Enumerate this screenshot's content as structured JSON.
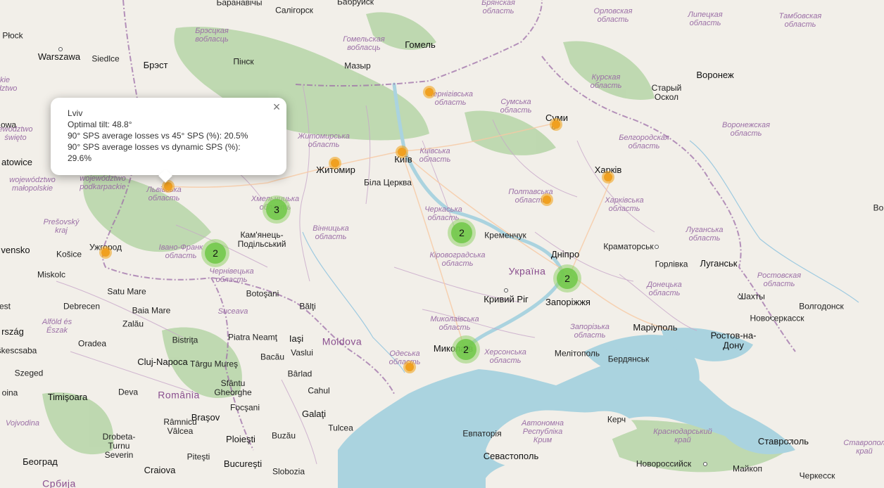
{
  "map": {
    "colors": {
      "land": "#f2efe9",
      "sea": "#aad3df",
      "forest": "#add19e",
      "border": "#9e6fa8",
      "region_label": "#9b6fa6",
      "marker": "#f0a020",
      "cluster": "#6ec846"
    },
    "labels": {
      "baranavichy": "Баранавічы",
      "salihorsk": "Салігорск",
      "babruysk": "Бабруйск",
      "bryansk_obl": "Брянская\nобласть",
      "oryol_obl": "Орловская\nобласть",
      "lipetsk_obl": "Липецкая\nобласть",
      "tambov_obl": "Тамбовская\nобласть",
      "plock": "Płock",
      "brest_obl": "Брэсцкая\nвобласць",
      "gomel_obl": "Гомельская\nвобласць",
      "gomel": "Гомель",
      "warszawa": "Warszawa",
      "siedlce": "Siedlce",
      "brest": "Брэст",
      "pinsk": "Пінск",
      "mazyr": "Мазыр",
      "mazowieckie": "kie\nodztwo",
      "chernihiv_obl": "Чернігівська\nобласть",
      "kursk_obl": "Курская\nобласть",
      "voronezh": "Воронеж",
      "stary_oskol": "Старый\nОскол",
      "lodzkie": "owa",
      "swietokrzyskie": "ewództwo\nświęto",
      "sumy_obl": "Сумська\nобласть",
      "sumy": "Суми",
      "voronezh_obl": "Воронежская\nобласть",
      "zhytomyr_obl": "Житомирська\nобласть",
      "belgorod_obl": "Белгородская\nобласть",
      "katowice": "atowice",
      "kyiv_obl": "Київська\nобласть",
      "kyiv": "Київ",
      "zhytomyr": "Житомир",
      "kharkiv": "Харків",
      "malopolskie": "województwo\nmałopolskie",
      "podkarpackie": "województwo\npodkarpackie",
      "lviv_obl": "Львівська\nобласть",
      "bila_tserkva": "Біла Церква",
      "poltava_obl": "Полтавська\nобласть",
      "kharkiv_obl": "Харківська\nобласть",
      "khmelnytsky_obl": "Хмельницька\nобласть",
      "presov": "Prešovský\nkraj",
      "cherkasy_obl": "Черкаська\nобласть",
      "kremenchuk": "Кременчук",
      "luhansk_obl": "Луганська\nобласть",
      "kamianets": "Кам'янець-\nПодільський",
      "vinnytsia_obl": "Вінницька\nобласть",
      "slovensko": "vensko",
      "kosice": "Košice",
      "uzhhorod": "Ужгород",
      "ivano_obl": "Івано-Франк\nобласть",
      "dnipro": "Дніпро",
      "kramatorsk": "Краматорськ",
      "kirovohrad_obl": "Кіровоградська\nобласть",
      "ukraina": "Україна",
      "horlivka": "Горлівка",
      "luhansk": "Луганськ",
      "miskolc": "Miskolc",
      "chernivtsi_obl": "Чернівецька\nобласть",
      "rostov_obl": "Ростовская\nобласть",
      "satu_mare": "Satu Mare",
      "botosani": "Botoşani",
      "kryvyi_rih": "Кривий Ріг",
      "zaporizhzhia": "Запоріжжя",
      "donetsk_obl": "Донецька\nобласть",
      "shakhty": "Шахты",
      "est": "est",
      "debrecen": "Debrecen",
      "baia_mare": "Baia Mare",
      "balti": "Bălţi",
      "volgodonsk": "Волгодонск",
      "mykolaiv_obl": "Миколаївська\nобласть",
      "suceava": "Suceava",
      "zalau": "Zalău",
      "alfold": "Alföld és\nÉszak",
      "novocherkassk": "Новочеркасск",
      "csongrad": "rszág",
      "zaporizhzhia_obl": "Запорізька\nобласть",
      "mariupol": "Маріуполь",
      "rostov": "Ростов-на-\nДону",
      "piatra_neamt": "Piatra Neamţ",
      "iasi": "Iaşi",
      "moldova": "Moldova",
      "oradea": "Oradea",
      "bistrita": "Bistriţa",
      "bekescsaba": "škescsaba",
      "vaslui": "Vaslui",
      "mykolaiv": "Миколаїв",
      "kherson_obl": "Херсонська\nобласть",
      "odesa_obl": "Одеська\nобласть",
      "bacau": "Bacău",
      "melitopol": "Мелітополь",
      "berdiansk": "Бердянськ",
      "cluj": "Cluj-Napoca",
      "targu_mures": "Târgu Mureş",
      "barlad": "Bârlad",
      "szeged": "Szeged",
      "sfantu": "Sfântu\nGheorghe",
      "cahul": "Cahul",
      "deva": "Deva",
      "romania": "România",
      "timisoara": "Timişoara",
      "oina": "oina",
      "focsani": "Focşani",
      "crimea": "Автономна\nРеспубліка\nКрим",
      "galati": "Galaţi",
      "brasov": "Braşov",
      "kerch": "Керч",
      "vojvodina": "Vojvodina",
      "tulcea": "Tulcea",
      "krasnodar": "Краснодарський\nкрай",
      "stavropol_kr": "Ставропол\nкрай",
      "ramnicu": "Râmnicu\nVâlcea",
      "buzau": "Buzău",
      "yevpatoria": "Евпаторія",
      "stavropol": "Ставрополь",
      "drobeta": "Drobeta-\nTurnu\nSeverin",
      "ploiesti": "Ploieşti",
      "beograd": "Београд",
      "sevastopol": "Севастополь",
      "pitesti": "Piteşti",
      "novorossiysk": "Новороссийск",
      "maikop": "Майкоп",
      "craiova": "Craiova",
      "bucuresti": "Bucureşti",
      "slobozia": "Slobozia",
      "cherkessk": "Черкесск",
      "srbija": "Србија",
      "ukr_e": "Во"
    },
    "markers": [
      "chernihiv-marker",
      "sumy-marker",
      "kyiv-marker",
      "zhytomyr-marker",
      "kharkiv-marker",
      "lviv-marker",
      "poltava-marker",
      "uzhhorod-marker",
      "odesa-marker"
    ],
    "clusters": {
      "khmelnytsky": "3",
      "ivano_frankivsk": "2",
      "cherkasy": "2",
      "dnipro_zaporizhzhia": "2",
      "mykolaiv": "2"
    },
    "popup": {
      "title": "Lviv",
      "line1": "Optimal tilt: 48.8°",
      "line2": "90° SPS average losses vs 45° SPS (%): 20.5%",
      "line3": "90° SPS average losses vs dynamic SPS (%):",
      "line4": "29.6%",
      "close": "×"
    }
  }
}
